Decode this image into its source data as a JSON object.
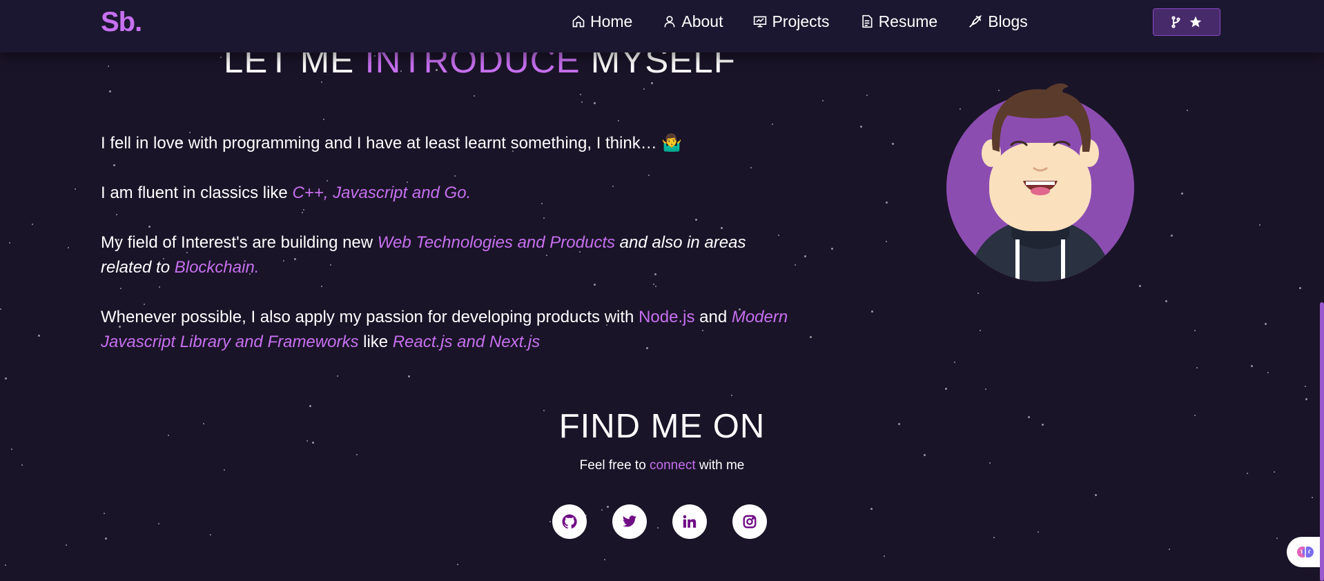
{
  "brand": {
    "logo": "Sb.",
    "accent": "#c770f0"
  },
  "nav": {
    "items": [
      {
        "label": "Home",
        "icon": "home-icon"
      },
      {
        "label": "About",
        "icon": "user-icon"
      },
      {
        "label": "Projects",
        "icon": "projects-icon"
      },
      {
        "label": "Resume",
        "icon": "document-icon"
      },
      {
        "label": "Blogs",
        "icon": "pen-icon"
      }
    ],
    "fork_button": {
      "icons": [
        "git-fork-icon",
        "star-icon"
      ]
    }
  },
  "about": {
    "heading_pre": "LET ME ",
    "heading_accent": "INTRODUCE",
    "heading_post": " MYSELF",
    "p1": "I fell in love with programming and I have at least learnt something, I think… ",
    "p1_emoji": "🤷‍♂️",
    "p2_pre": "I am fluent in classics like ",
    "p2_accent": "C++, Javascript and Go.",
    "p3_pre": "My field of Interest's are building new  ",
    "p3_accent": "Web Technologies and Products",
    "p3_mid": " and also in areas related to ",
    "p3_accent2": "Blockchain.",
    "p4_pre": "Whenever possible, I also apply my passion for developing products with ",
    "p4_accent": "Node.js",
    "p4_mid": " and ",
    "p4_accent2": "Modern Javascript Library and Frameworks",
    "p4_mid2": "  like ",
    "p4_accent3": "React.js and Next.js"
  },
  "find_me": {
    "title": "FIND ME ON",
    "sub_pre": "Feel free to ",
    "sub_accent": "connect",
    "sub_post": " with me",
    "socials": [
      "github-icon",
      "twitter-icon",
      "linkedin-icon",
      "instagram-icon"
    ]
  },
  "colors": {
    "background": "#1a1428",
    "navbar": "#1c1730",
    "accent": "#c770f0",
    "social_icon": "#700c86"
  }
}
